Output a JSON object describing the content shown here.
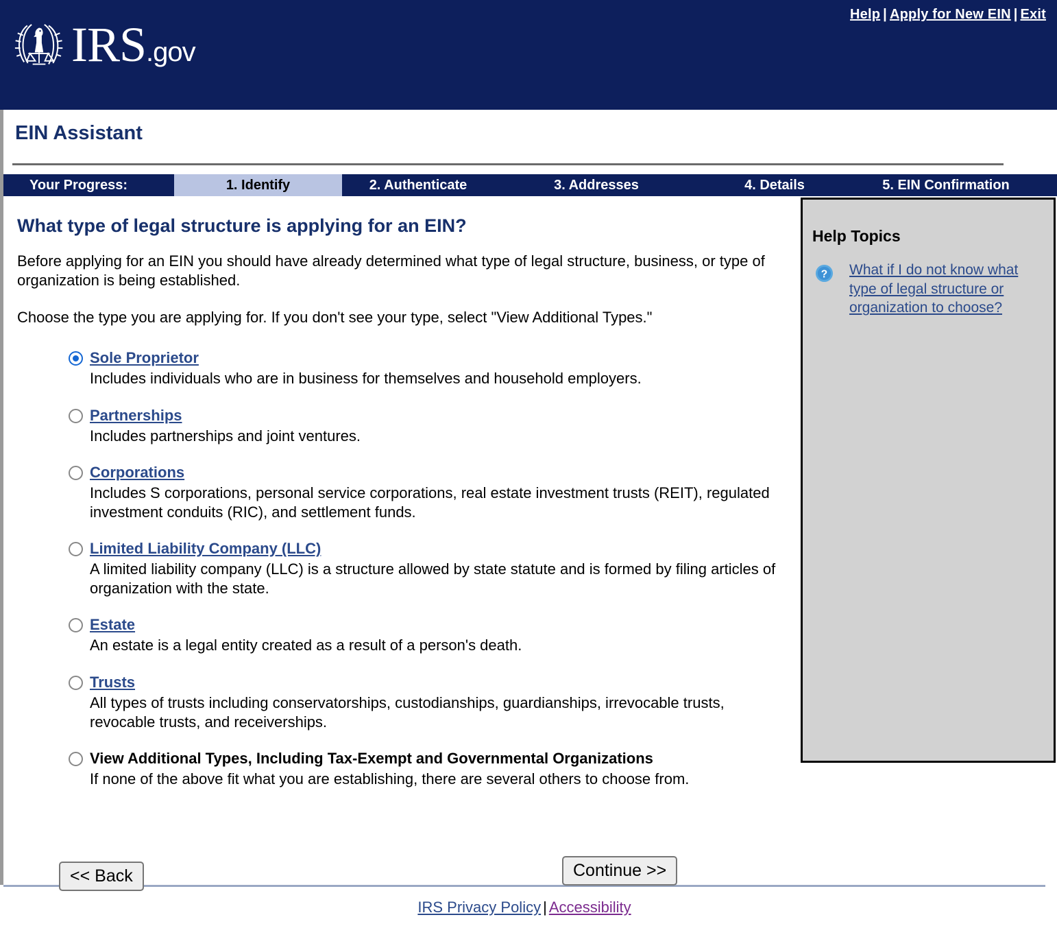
{
  "masthead": {
    "logo_text": "IRS",
    "logo_suffix": ".gov",
    "logo_emblem_name": "irs-eagle-scales-emblem",
    "top_links": [
      {
        "label": "Help",
        "name": "help-link"
      },
      {
        "label": "Apply for New EIN",
        "name": "apply-new-ein-link"
      },
      {
        "label": "Exit",
        "name": "exit-link"
      }
    ],
    "separator": "|"
  },
  "header": {
    "title": "EIN Assistant"
  },
  "progress": {
    "label": "Your Progress:",
    "steps": [
      {
        "label": "1. Identify",
        "active": true
      },
      {
        "label": "2. Authenticate",
        "active": false
      },
      {
        "label": "3. Addresses",
        "active": false
      },
      {
        "label": "4. Details",
        "active": false
      },
      {
        "label": "5. EIN Confirmation",
        "active": false
      }
    ]
  },
  "main": {
    "heading": "What type of legal structure is applying for an EIN?",
    "paragraph1": "Before applying for an EIN you should have already determined what type of legal structure, business, or type of organization is being established.",
    "paragraph2": "Choose the type you are applying for. If you don't see your type, select \"View Additional Types.\"",
    "options": [
      {
        "title": "Sole Proprietor",
        "description": "Includes individuals who are in business for themselves and household employers.",
        "selected": true,
        "is_link": true
      },
      {
        "title": "Partnerships",
        "description": "Includes partnerships and joint ventures.",
        "selected": false,
        "is_link": true
      },
      {
        "title": "Corporations",
        "description": "Includes S corporations, personal service corporations, real estate investment trusts (REIT), regulated investment conduits (RIC), and settlement funds.",
        "selected": false,
        "is_link": true
      },
      {
        "title": "Limited Liability Company (LLC)",
        "description": "A limited liability company (LLC) is a structure allowed by state statute and is formed by filing articles of organization with the state.",
        "selected": false,
        "is_link": true
      },
      {
        "title": "Estate",
        "description": "An estate is a legal entity created as a result of a person's death.",
        "selected": false,
        "is_link": true
      },
      {
        "title": "Trusts",
        "description": "All types of trusts including conservatorships, custodianships, guardianships, irrevocable trusts, revocable trusts, and receiverships.",
        "selected": false,
        "is_link": true
      },
      {
        "title": "View Additional Types, Including Tax-Exempt and Governmental Organizations",
        "description": "If none of the above fit what you are establishing, there are several others to choose from.",
        "selected": false,
        "is_link": false
      }
    ]
  },
  "help": {
    "heading": "Help Topics",
    "icon_name": "question-mark-icon",
    "topics": [
      {
        "label": "What if I do not know what type of legal structure or organization to choose?"
      }
    ]
  },
  "footer": {
    "back_label": "<< Back",
    "continue_label": "Continue >>",
    "privacy_label": "IRS Privacy Policy",
    "separator": "|",
    "accessibility_label": "Accessibility"
  },
  "colors": {
    "masthead_blue": "#0d1f5c",
    "heading_blue": "#17306b",
    "link_blue": "#2b4a8b",
    "active_step_bg": "#b9c4e2",
    "help_panel_bg": "#d2d2d2",
    "radio_selected": "#1567d3",
    "visited_link_purple": "#7b2a8e"
  }
}
